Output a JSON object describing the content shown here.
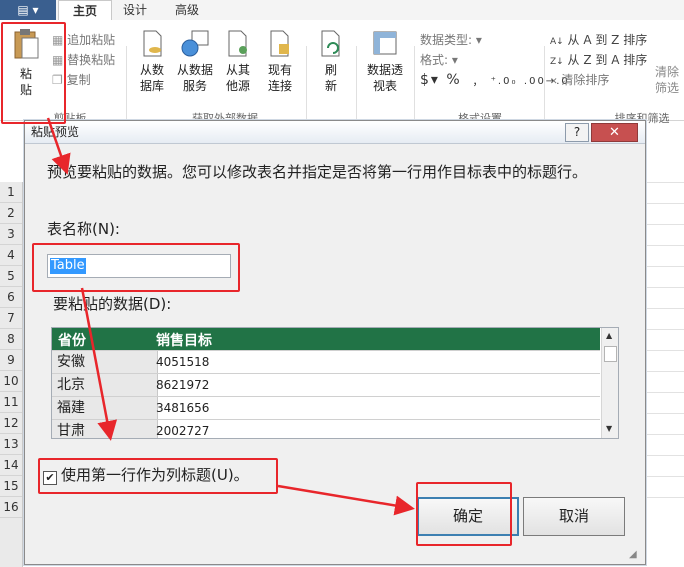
{
  "ribbon": {
    "tabs": [
      "主页",
      "设计",
      "高级"
    ],
    "paste_label": "粘\n贴",
    "clipboard_items": [
      "追加粘贴",
      "替换粘贴",
      "复制"
    ],
    "clipboard_group": "剪贴板",
    "external_buttons": [
      "从数\n据库",
      "从数据\n服务",
      "从其\n他源",
      "现有\n连接"
    ],
    "external_group": "获取外部数据",
    "refresh_label": "刷\n新",
    "pivot_label": "数据透\n视表",
    "format_items": [
      "数据类型:",
      "格式:"
    ],
    "number_symbols": [
      "$",
      "%",
      "﹐",
      "⁺.0₀",
      ".00→.0"
    ],
    "format_group": "格式设置",
    "sort_items": [
      "从 A 到 Z 排序",
      "从 Z 到 A 排序",
      "清除排序"
    ],
    "clear_filter_label": "清除\n筛选",
    "sort_group": "排序和筛选"
  },
  "sheet": {
    "row_numbers": [
      "1",
      "2",
      "3",
      "4",
      "5",
      "6",
      "7",
      "8",
      "9",
      "10",
      "11",
      "12",
      "13",
      "14",
      "15",
      "16"
    ]
  },
  "dialog": {
    "title": "粘贴预览",
    "help": "?",
    "close": "✕",
    "description": "预览要粘贴的数据。您可以修改表名并指定是否将第一行用作目标表中的标题行。",
    "table_name_label": "表名称(N):",
    "table_name_value": "Table",
    "data_label": "要粘贴的数据(D):",
    "columns": [
      "省份",
      "销售目标"
    ],
    "rows": [
      {
        "province": "安徽",
        "target": "4051518"
      },
      {
        "province": "北京",
        "target": "8621972"
      },
      {
        "province": "福建",
        "target": "3481656"
      },
      {
        "province": "甘肃",
        "target": "2002727"
      }
    ],
    "checkbox_checked": true,
    "checkbox_label": "使用第一行作为列标题(U)。",
    "ok": "确定",
    "cancel": "取消"
  },
  "colors": {
    "accent_green": "#217346",
    "annotation_red": "#e8262b",
    "selection_blue": "#3399ff"
  }
}
